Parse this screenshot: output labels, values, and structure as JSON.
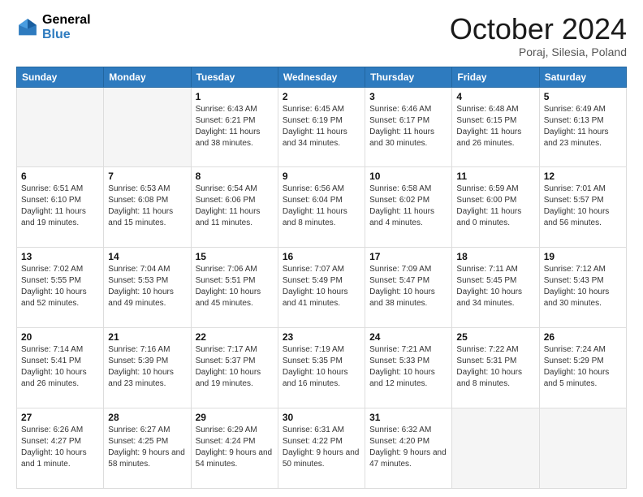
{
  "header": {
    "logo_line1": "General",
    "logo_line2": "Blue",
    "month": "October 2024",
    "location": "Poraj, Silesia, Poland"
  },
  "weekdays": [
    "Sunday",
    "Monday",
    "Tuesday",
    "Wednesday",
    "Thursday",
    "Friday",
    "Saturday"
  ],
  "weeks": [
    [
      {
        "day": "",
        "info": ""
      },
      {
        "day": "",
        "info": ""
      },
      {
        "day": "1",
        "info": "Sunrise: 6:43 AM\nSunset: 6:21 PM\nDaylight: 11 hours and 38 minutes."
      },
      {
        "day": "2",
        "info": "Sunrise: 6:45 AM\nSunset: 6:19 PM\nDaylight: 11 hours and 34 minutes."
      },
      {
        "day": "3",
        "info": "Sunrise: 6:46 AM\nSunset: 6:17 PM\nDaylight: 11 hours and 30 minutes."
      },
      {
        "day": "4",
        "info": "Sunrise: 6:48 AM\nSunset: 6:15 PM\nDaylight: 11 hours and 26 minutes."
      },
      {
        "day": "5",
        "info": "Sunrise: 6:49 AM\nSunset: 6:13 PM\nDaylight: 11 hours and 23 minutes."
      }
    ],
    [
      {
        "day": "6",
        "info": "Sunrise: 6:51 AM\nSunset: 6:10 PM\nDaylight: 11 hours and 19 minutes."
      },
      {
        "day": "7",
        "info": "Sunrise: 6:53 AM\nSunset: 6:08 PM\nDaylight: 11 hours and 15 minutes."
      },
      {
        "day": "8",
        "info": "Sunrise: 6:54 AM\nSunset: 6:06 PM\nDaylight: 11 hours and 11 minutes."
      },
      {
        "day": "9",
        "info": "Sunrise: 6:56 AM\nSunset: 6:04 PM\nDaylight: 11 hours and 8 minutes."
      },
      {
        "day": "10",
        "info": "Sunrise: 6:58 AM\nSunset: 6:02 PM\nDaylight: 11 hours and 4 minutes."
      },
      {
        "day": "11",
        "info": "Sunrise: 6:59 AM\nSunset: 6:00 PM\nDaylight: 11 hours and 0 minutes."
      },
      {
        "day": "12",
        "info": "Sunrise: 7:01 AM\nSunset: 5:57 PM\nDaylight: 10 hours and 56 minutes."
      }
    ],
    [
      {
        "day": "13",
        "info": "Sunrise: 7:02 AM\nSunset: 5:55 PM\nDaylight: 10 hours and 52 minutes."
      },
      {
        "day": "14",
        "info": "Sunrise: 7:04 AM\nSunset: 5:53 PM\nDaylight: 10 hours and 49 minutes."
      },
      {
        "day": "15",
        "info": "Sunrise: 7:06 AM\nSunset: 5:51 PM\nDaylight: 10 hours and 45 minutes."
      },
      {
        "day": "16",
        "info": "Sunrise: 7:07 AM\nSunset: 5:49 PM\nDaylight: 10 hours and 41 minutes."
      },
      {
        "day": "17",
        "info": "Sunrise: 7:09 AM\nSunset: 5:47 PM\nDaylight: 10 hours and 38 minutes."
      },
      {
        "day": "18",
        "info": "Sunrise: 7:11 AM\nSunset: 5:45 PM\nDaylight: 10 hours and 34 minutes."
      },
      {
        "day": "19",
        "info": "Sunrise: 7:12 AM\nSunset: 5:43 PM\nDaylight: 10 hours and 30 minutes."
      }
    ],
    [
      {
        "day": "20",
        "info": "Sunrise: 7:14 AM\nSunset: 5:41 PM\nDaylight: 10 hours and 26 minutes."
      },
      {
        "day": "21",
        "info": "Sunrise: 7:16 AM\nSunset: 5:39 PM\nDaylight: 10 hours and 23 minutes."
      },
      {
        "day": "22",
        "info": "Sunrise: 7:17 AM\nSunset: 5:37 PM\nDaylight: 10 hours and 19 minutes."
      },
      {
        "day": "23",
        "info": "Sunrise: 7:19 AM\nSunset: 5:35 PM\nDaylight: 10 hours and 16 minutes."
      },
      {
        "day": "24",
        "info": "Sunrise: 7:21 AM\nSunset: 5:33 PM\nDaylight: 10 hours and 12 minutes."
      },
      {
        "day": "25",
        "info": "Sunrise: 7:22 AM\nSunset: 5:31 PM\nDaylight: 10 hours and 8 minutes."
      },
      {
        "day": "26",
        "info": "Sunrise: 7:24 AM\nSunset: 5:29 PM\nDaylight: 10 hours and 5 minutes."
      }
    ],
    [
      {
        "day": "27",
        "info": "Sunrise: 6:26 AM\nSunset: 4:27 PM\nDaylight: 10 hours and 1 minute."
      },
      {
        "day": "28",
        "info": "Sunrise: 6:27 AM\nSunset: 4:25 PM\nDaylight: 9 hours and 58 minutes."
      },
      {
        "day": "29",
        "info": "Sunrise: 6:29 AM\nSunset: 4:24 PM\nDaylight: 9 hours and 54 minutes."
      },
      {
        "day": "30",
        "info": "Sunrise: 6:31 AM\nSunset: 4:22 PM\nDaylight: 9 hours and 50 minutes."
      },
      {
        "day": "31",
        "info": "Sunrise: 6:32 AM\nSunset: 4:20 PM\nDaylight: 9 hours and 47 minutes."
      },
      {
        "day": "",
        "info": ""
      },
      {
        "day": "",
        "info": ""
      }
    ]
  ]
}
